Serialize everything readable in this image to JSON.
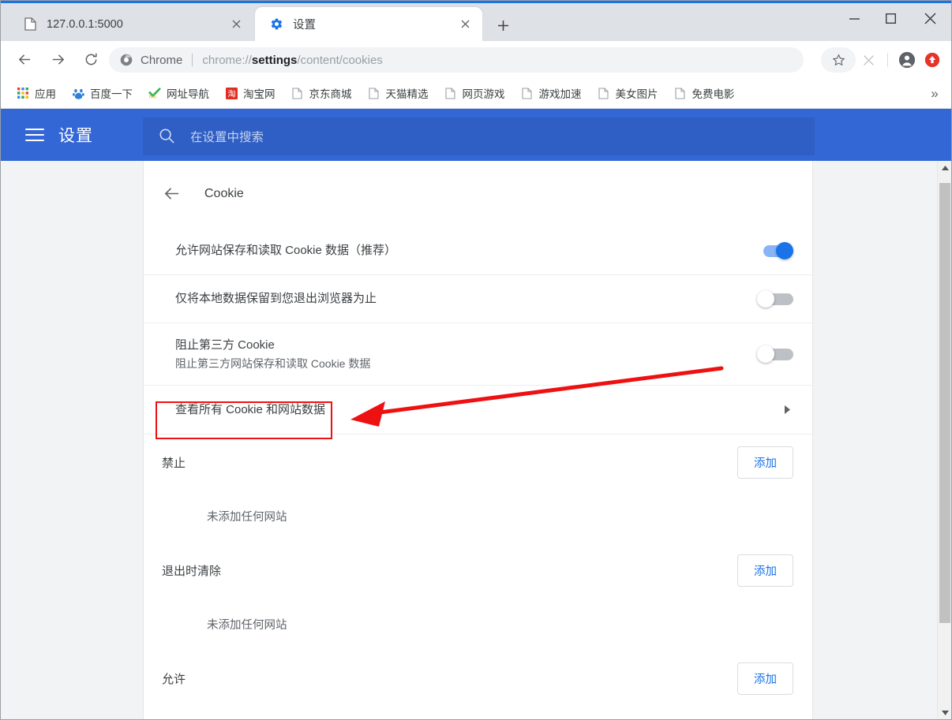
{
  "window": {
    "controls": {
      "minimize": "minimize-icon",
      "maximize": "maximize-icon",
      "close": "close-icon"
    }
  },
  "tabs": [
    {
      "title": "127.0.0.1:5000",
      "favicon": "page-icon",
      "active": false
    },
    {
      "title": "设置",
      "favicon": "gear-icon",
      "active": true
    }
  ],
  "newtab_label": "+",
  "toolbar": {
    "back": "back-arrow-icon",
    "forward": "forward-arrow-icon",
    "reload": "reload-icon",
    "omnibox": {
      "chrome_label": "Chrome",
      "url_prefix": "chrome://",
      "url_bold": "settings",
      "url_suffix": "/content/cookies",
      "full_url": "chrome://settings/content/cookies"
    },
    "star_icon": "star-icon",
    "extension_icon": "x-extension-icon",
    "profile_icon": "profile-avatar-icon",
    "update_icon": "update-arrow-icon"
  },
  "bookmarks": {
    "items": [
      {
        "label": "应用",
        "icon": "apps-grid-icon"
      },
      {
        "label": "百度一下",
        "icon": "baidu-icon"
      },
      {
        "label": "网址导航",
        "icon": "hao123-icon"
      },
      {
        "label": "淘宝网",
        "icon": "taobao-icon"
      },
      {
        "label": "京东商城",
        "icon": "page-icon"
      },
      {
        "label": "天猫精选",
        "icon": "page-icon"
      },
      {
        "label": "网页游戏",
        "icon": "page-icon"
      },
      {
        "label": "游戏加速",
        "icon": "page-icon"
      },
      {
        "label": "美女图片",
        "icon": "page-icon"
      },
      {
        "label": "免费电影",
        "icon": "page-icon"
      }
    ],
    "overflow_label": "»"
  },
  "settings_header": {
    "menu_icon": "hamburger-menu-icon",
    "title": "设置",
    "search_icon": "search-icon",
    "search_placeholder": "在设置中搜索",
    "search_value": ""
  },
  "page": {
    "back_icon": "back-arrow-icon",
    "title": "Cookie",
    "rows": [
      {
        "title": "允许网站保存和读取 Cookie 数据（推荐）",
        "sub": "",
        "toggle": "on"
      },
      {
        "title": "仅将本地数据保留到您退出浏览器为止",
        "sub": "",
        "toggle": "off"
      },
      {
        "title": "阻止第三方 Cookie",
        "sub": "阻止第三方网站保存和读取 Cookie 数据",
        "toggle": "off"
      }
    ],
    "link_row": {
      "title": "查看所有 Cookie 和网站数据",
      "chevron": "chevron-right-icon"
    },
    "sections": [
      {
        "title": "禁止",
        "add_label": "添加",
        "empty": "未添加任何网站"
      },
      {
        "title": "退出时清除",
        "add_label": "添加",
        "empty": "未添加任何网站"
      },
      {
        "title": "允许",
        "add_label": "添加",
        "empty": ""
      }
    ]
  },
  "scrollbar": {
    "up_arrow": "scroll-up-icon",
    "down_arrow": "scroll-down-icon"
  },
  "annotation": {
    "color": "#ee1111",
    "highlight_target": "查看所有 Cookie 和网站数据"
  },
  "colors": {
    "tabstrip": "#dee1e6",
    "accent_blue": "#1a73e8",
    "settings_header": "#3367d6",
    "search_field": "#2f5fc4",
    "content_bg": "#f1f3f4",
    "annotation_red": "#ee1111"
  }
}
